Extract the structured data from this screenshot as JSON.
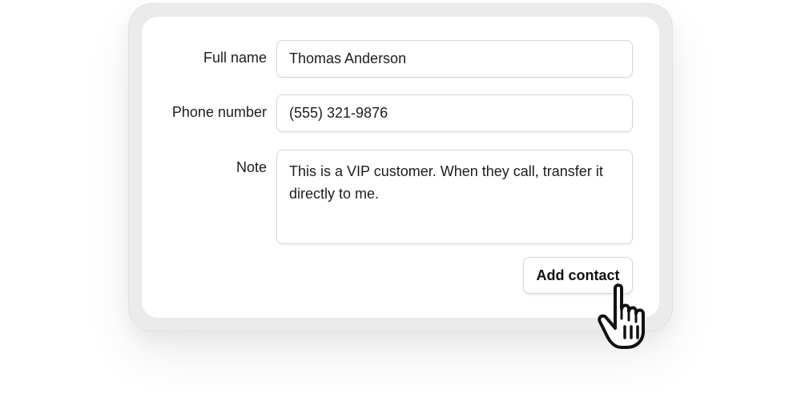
{
  "form": {
    "full_name": {
      "label": "Full name",
      "value": "Thomas Anderson"
    },
    "phone_number": {
      "label": "Phone number",
      "value": "(555) 321-9876"
    },
    "note": {
      "label": "Note",
      "value": "This is a VIP customer. When they call, transfer it directly to me."
    },
    "submit_label": "Add contact"
  },
  "cursor": {
    "icon": "hand-pointer-icon"
  }
}
